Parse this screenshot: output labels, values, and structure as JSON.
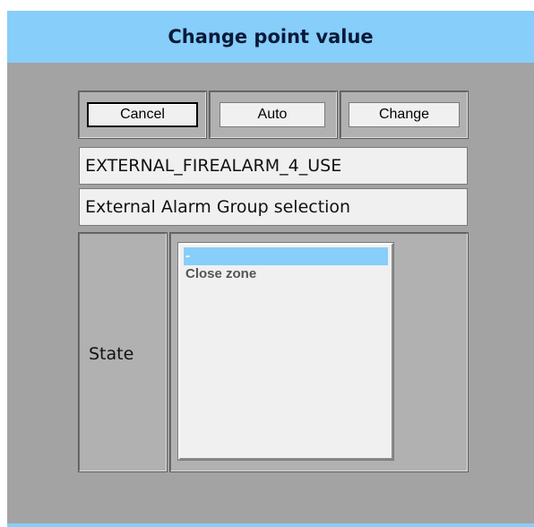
{
  "dialog": {
    "title": "Change point value",
    "colors": {
      "titlebar": "#87cefa",
      "body": "#a3a3a3",
      "selection": "#87cefa"
    }
  },
  "buttons": {
    "cancel_label": "Cancel",
    "auto_label": "Auto",
    "change_label": "Change"
  },
  "point": {
    "name": "EXTERNAL_FIREALARM_4_USE",
    "description": "External Alarm Group selection"
  },
  "state": {
    "label": "State",
    "options": [
      {
        "label": "-",
        "selected": true
      },
      {
        "label": "Close zone",
        "selected": false
      }
    ]
  }
}
